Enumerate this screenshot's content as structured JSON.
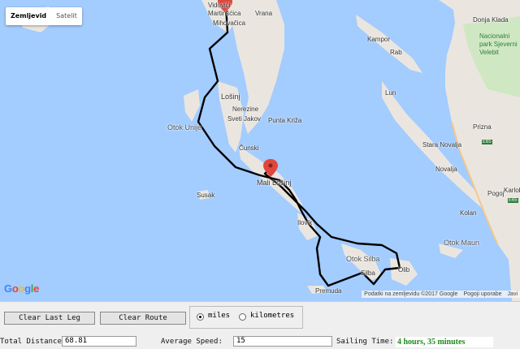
{
  "map": {
    "map_type": {
      "active": "Zemljevid",
      "inactive": "Satelit"
    },
    "google_logo": [
      "G",
      "o",
      "o",
      "g",
      "l",
      "e"
    ],
    "logo_colors": [
      "#4285f4",
      "#ea4335",
      "#fbbc05",
      "#4285f4",
      "#34a853",
      "#ea4335"
    ],
    "attribution": {
      "data": "Podatki na zemljevidu ©2017 Google",
      "terms": "Pogoji uporabe",
      "report": "Javi"
    },
    "colors": {
      "sea": "#a3ccff",
      "land": "#eae6df",
      "park": "#cfe8c3",
      "route": "#000000",
      "marker": "#e0463b"
    },
    "places": {
      "vrana": "Vrana",
      "martinscica": "Martinšćica",
      "mihovacica": "Mihovačica",
      "vis": "Vidovići",
      "losinj": "Lošinj",
      "nerezine": "Nerezine",
      "sveti_jakov": "Sveti Jakov",
      "punta_kriza": "Punta Križa",
      "cunski": "Čunski",
      "mali_losinj": "Mali Lošinj",
      "ilovik": "Ilovik",
      "otok_unije": "Otok Unije",
      "susak": "Susak",
      "otok_silba": "Otok Silba",
      "silba": "Silba",
      "olib": "Olib",
      "premuda": "Premuda",
      "kampor": "Kampor",
      "rab": "Rab",
      "lun": "Lun",
      "stara_novalja": "Stara Novalja",
      "novalja": "Novalja",
      "kolan": "Kolan",
      "otok_maun": "Otok Maun",
      "donja_klada": "Donja Klada",
      "national_park": "Nacionalni\npark Sjeverni\nVelebit",
      "prizna": "Prizna",
      "pogoj": "Pogoj",
      "karlobag": "Karlobag",
      "e65_a": "E65",
      "e65_b": "E65"
    }
  },
  "controls": {
    "clear_last_leg": "Clear Last Leg",
    "clear_route": "Clear Route",
    "units": {
      "miles": "miles",
      "kilometres": "kilometres",
      "selected": "miles"
    },
    "total_distance_label": "Total Distance",
    "total_distance_value": "68.81",
    "average_speed_label": "Average Speed:",
    "average_speed_value": "15",
    "sailing_time_label": "Sailing Time:",
    "sailing_time_value": "4 hours, 35 minutes"
  }
}
